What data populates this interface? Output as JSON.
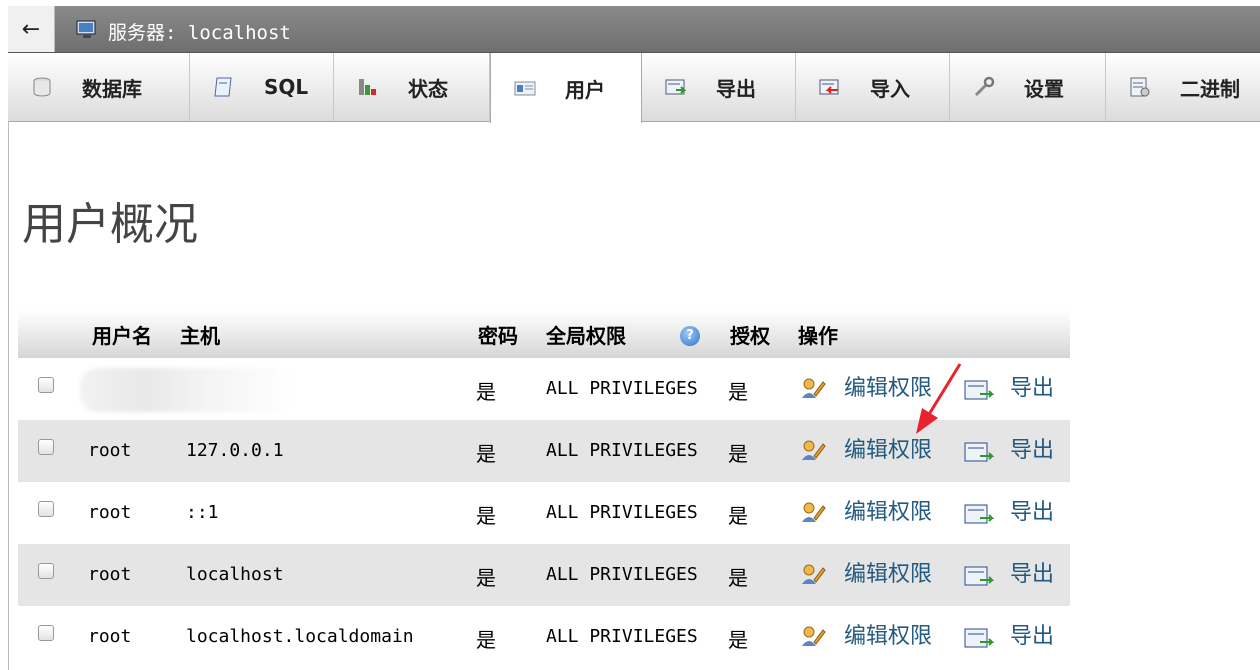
{
  "server_bar": {
    "back_symbol": "←",
    "label": "服务器: localhost"
  },
  "tabs": [
    {
      "label": "数据库",
      "icon": "database-icon",
      "active": false
    },
    {
      "label": "SQL",
      "icon": "sql-icon",
      "active": false
    },
    {
      "label": "状态",
      "icon": "status-icon",
      "active": false
    },
    {
      "label": "用户",
      "icon": "users-icon",
      "active": true
    },
    {
      "label": "导出",
      "icon": "export-icon",
      "active": false
    },
    {
      "label": "导入",
      "icon": "import-icon",
      "active": false
    },
    {
      "label": "设置",
      "icon": "settings-icon",
      "active": false
    },
    {
      "label": "二进制",
      "icon": "binlog-icon",
      "active": false
    }
  ],
  "page_title": "用户概况",
  "table": {
    "headers": {
      "username": "用户名",
      "host": "主机",
      "password": "密码",
      "global_privileges": "全局权限",
      "grant": "授权",
      "action": "操作"
    },
    "help_symbol": "?",
    "rows": [
      {
        "username": "",
        "host": "",
        "password": "是",
        "privileges": "ALL PRIVILEGES",
        "grant": "是",
        "edit": "编辑权限",
        "export": "导出",
        "redacted": true
      },
      {
        "username": "root",
        "host": "127.0.0.1",
        "password": "是",
        "privileges": "ALL PRIVILEGES",
        "grant": "是",
        "edit": "编辑权限",
        "export": "导出"
      },
      {
        "username": "root",
        "host": "::1",
        "password": "是",
        "privileges": "ALL PRIVILEGES",
        "grant": "是",
        "edit": "编辑权限",
        "export": "导出"
      },
      {
        "username": "root",
        "host": "localhost",
        "password": "是",
        "privileges": "ALL PRIVILEGES",
        "grant": "是",
        "edit": "编辑权限",
        "export": "导出"
      },
      {
        "username": "root",
        "host": "localhost.localdomain",
        "password": "是",
        "privileges": "ALL PRIVILEGES",
        "grant": "是",
        "edit": "编辑权限",
        "export": "导出"
      }
    ]
  },
  "colors": {
    "link": "#235a81",
    "annotation_arrow": "#e8232b",
    "row_alt": "#e5e5e5"
  }
}
